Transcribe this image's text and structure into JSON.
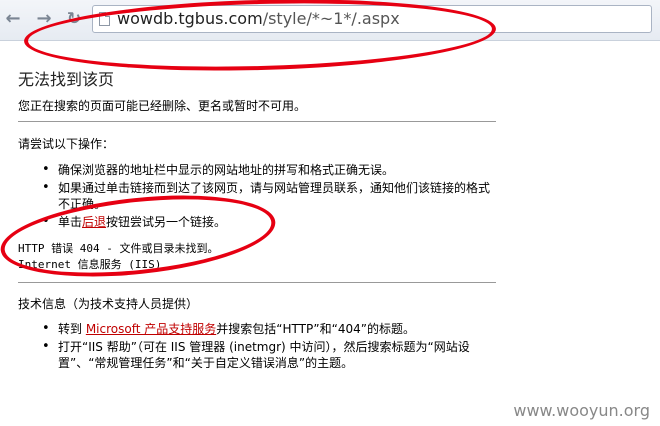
{
  "browser": {
    "url_host": "wowdb.tgbus.com",
    "url_path": "/style/*~1*/.aspx"
  },
  "page": {
    "title": "无法找到该页",
    "subtitle": "您正在搜索的页面可能已经删除、更名或暂时不可用。",
    "section1_title": "请尝试以下操作：",
    "items1": [
      "确保浏览器的地址栏中显示的网站地址的拼写和格式正确无误。",
      "如果通过单击链接而到达了该网页，请与网站管理员联系，通知他们该链接的格式不正确。"
    ],
    "item3_prefix": "单击",
    "item3_link": "后退",
    "item3_suffix": "按钮尝试另一个链接。",
    "error_line": "HTTP 错误 404 - 文件或目录未找到。",
    "server_line": "Internet 信息服务 (IIS)",
    "section2_title": "技术信息（为技术支持人员提供）",
    "tech_item1_prefix": "转到 ",
    "tech_item1_link": "Microsoft 产品支持服务",
    "tech_item1_suffix": "并搜索包括“HTTP”和“404”的标题。",
    "tech_item2": "打开“IIS 帮助”（可在 IIS 管理器 (inetmgr) 中访问），然后搜索标题为“网站设置”、“常规管理任务”和“关于自定义错误消息”的主题。"
  },
  "watermark": "www.wooyun.org",
  "colors": {
    "annotation": "#e60012",
    "link": "#c00000"
  }
}
